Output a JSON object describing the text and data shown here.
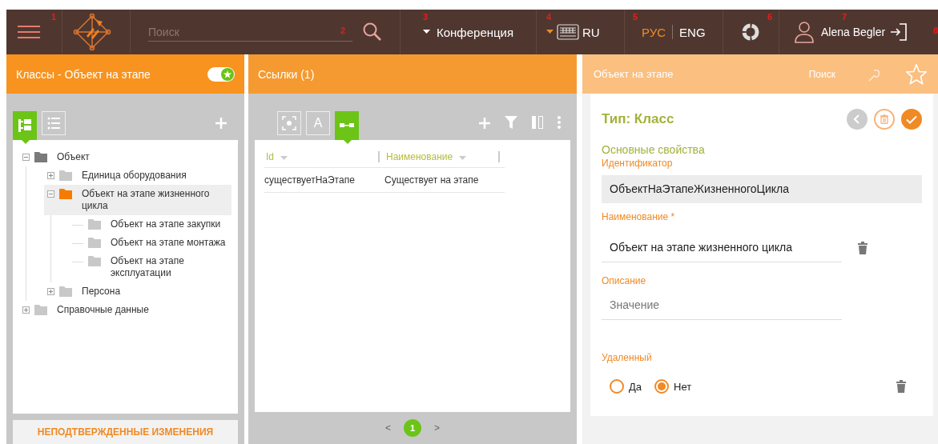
{
  "header": {
    "menu_marker": "1",
    "search": {
      "placeholder": "Поиск",
      "marker": "2"
    },
    "conference": {
      "label": "Конференция",
      "marker": "3"
    },
    "keyboard": {
      "label": "RU",
      "marker": "4"
    },
    "languages": [
      {
        "label": "РУС",
        "selected": true
      },
      {
        "label": "ENG",
        "selected": false
      }
    ],
    "languages_marker": "5",
    "sync_marker": "6",
    "user": {
      "name": "Alena Begler",
      "marker": "7"
    },
    "logout_marker": "8"
  },
  "classes_panel": {
    "title": "Классы - Объект на этапе",
    "toggle_on": true,
    "views": [
      {
        "kind": "tree",
        "selected": true
      },
      {
        "kind": "list",
        "selected": false
      }
    ],
    "tree": [
      {
        "label": "Объект",
        "kind": "branch",
        "expanded": true,
        "selected": false,
        "color": "#7a7a7a",
        "children": [
          {
            "label": "Единица оборудования",
            "kind": "branch",
            "expanded": false,
            "selected": false,
            "color": "#c8c8c8"
          },
          {
            "label": "Объект на этапе жизненного цикла",
            "kind": "branch",
            "expanded": true,
            "selected": true,
            "color": "#f57c00",
            "children": [
              {
                "label": "Объект на этапе закупки",
                "kind": "leaf",
                "selected": false,
                "color": "#c8c8c8"
              },
              {
                "label": "Объект на этапе монтажа",
                "kind": "leaf",
                "selected": false,
                "color": "#c8c8c8"
              },
              {
                "label": "Объект на этапе эксплуатации",
                "kind": "leaf",
                "selected": false,
                "color": "#c8c8c8"
              }
            ]
          },
          {
            "label": "Персона",
            "kind": "branch",
            "expanded": false,
            "selected": false,
            "color": "#c8c8c8"
          }
        ]
      },
      {
        "label": "Справочные данные",
        "kind": "branch",
        "expanded": false,
        "selected": false,
        "color": "#c8c8c8"
      }
    ],
    "footer_button": "НЕПОДТВЕРЖДЕННЫЕ ИЗМЕНЕНИЯ"
  },
  "links_panel": {
    "title": "Ссылки (1)",
    "views": [
      {
        "kind": "focus",
        "selected": false
      },
      {
        "kind": "text",
        "label": "A",
        "selected": false
      },
      {
        "kind": "link",
        "selected": true
      }
    ],
    "table": {
      "columns": [
        "Id",
        "Наименование"
      ],
      "rows": [
        [
          "существуетНаЭтапе",
          "Существует на этапе"
        ]
      ]
    },
    "pagination": {
      "prev": "<",
      "pages": [
        {
          "label": "1",
          "selected": true
        }
      ],
      "next": ">"
    }
  },
  "detail_panel": {
    "title": "Объект на этапе",
    "search_label": "Поиск",
    "type_title": "Тип: Класс",
    "actions": [
      {
        "kind": "back",
        "disabled": true
      },
      {
        "kind": "delete",
        "disabled": false
      },
      {
        "kind": "confirm",
        "disabled": false
      }
    ],
    "section": "Основные свойства",
    "fields": [
      {
        "kind": "readonly",
        "label": "Идентификатор",
        "value": "ОбъектНаЭтапеЖизненногоЦикла",
        "deletable": false
      },
      {
        "kind": "text",
        "label": "Наименование *",
        "value": "Объект на этапе жизненного цикла",
        "deletable": true
      },
      {
        "kind": "text",
        "label": "Описание",
        "placeholder": "Значение",
        "deletable": false
      },
      {
        "kind": "radio",
        "label": "Удаленный",
        "options": [
          {
            "label": "Да",
            "selected": false
          },
          {
            "label": "Нет",
            "selected": true
          }
        ],
        "deletable": true
      }
    ]
  }
}
